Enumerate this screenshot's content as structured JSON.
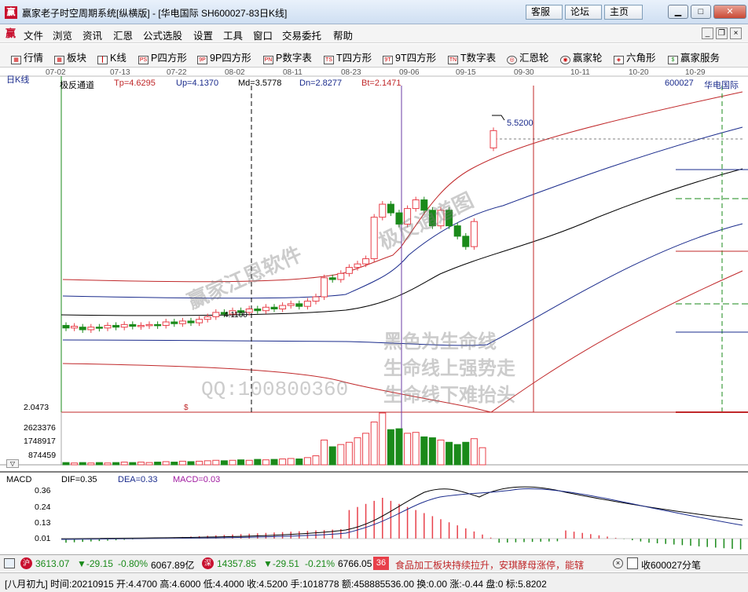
{
  "window": {
    "title": "赢家老子时空周期系统[纵横版] - [华电国际  SH600027-83日K线]",
    "app_icon": "赢",
    "nav_buttons": [
      "客服",
      "论坛",
      "主页"
    ]
  },
  "menu": {
    "logo": "赢",
    "items": [
      "文件",
      "浏览",
      "资讯",
      "汇恩",
      "公式选股",
      "设置",
      "工具",
      "窗口",
      "交易委托",
      "帮助"
    ]
  },
  "toolbar": {
    "items": [
      {
        "icon": "grid-icon",
        "glyph": "▦",
        "label": "行情"
      },
      {
        "icon": "blocks-icon",
        "glyph": "▦",
        "label": "板块"
      },
      {
        "icon": "kline-icon",
        "glyph": "┃",
        "label": "K线"
      },
      {
        "icon": "ps-icon",
        "glyph": "PS",
        "label": "P四方形"
      },
      {
        "icon": "9p-icon",
        "glyph": "9P",
        "label": "9P四方形"
      },
      {
        "icon": "pn-icon",
        "glyph": "PN",
        "label": "P数字表"
      },
      {
        "icon": "ts-icon",
        "glyph": "TS",
        "label": "T四方形"
      },
      {
        "icon": "9t-icon",
        "glyph": "9T",
        "label": "9T四方形"
      },
      {
        "icon": "tn-icon",
        "glyph": "TN",
        "label": "T数字表"
      },
      {
        "icon": "target-icon",
        "glyph": "◎",
        "label": "汇恩轮"
      },
      {
        "icon": "wheel-icon",
        "glyph": "◉",
        "label": "赢家轮"
      },
      {
        "icon": "hexagon-icon",
        "glyph": "◈",
        "label": "六角形"
      },
      {
        "icon": "dollar-icon",
        "glyph": "$",
        "label": "赢家服务"
      }
    ]
  },
  "chart_header": {
    "period_label": "日K线",
    "indicator_name": "极反通道",
    "tp": "Tp=4.6295",
    "up": "Up=4.1370",
    "md": "Md=3.5778",
    "dn": "Dn=2.8277",
    "bt": "Bt=2.1471",
    "stock_code": "600027",
    "stock_name": "华电国际"
  },
  "timeline": [
    "07-02",
    "07-13",
    "07-22",
    "08-02",
    "08-11",
    "08-23",
    "09-06",
    "09-15",
    "09-30",
    "10-11",
    "10-20",
    "10-29"
  ],
  "price_labels": {
    "high_marker": "5.5200",
    "low_axis": "2.0473",
    "mid_marker": "4.1100",
    "dollar": "$"
  },
  "volume_axis": [
    "2623376",
    "1748917",
    "874459"
  ],
  "watermarks": {
    "w1": "赢家江恩软件",
    "w2": "极反通道图",
    "w3": "黑色为生命线",
    "w4": "生命线上强势走",
    "w5": "生命线下难抬头",
    "qq": "QQ:100800360"
  },
  "macd": {
    "title": "MACD",
    "dif": "DIF=0.35",
    "dea": "DEA=0.33",
    "macd": "MACD=0.03",
    "axis": [
      "0.36",
      "0.24",
      "0.13",
      "0.01"
    ]
  },
  "status1": {
    "sh_index": "3613.07",
    "sh_change": "▼-29.15",
    "sh_pct": "-0.80%",
    "sh_amount": "6067.89亿",
    "sz_index": "14357.85",
    "sz_change": "▼-29.51",
    "sz_pct": "-0.21%",
    "sz_amount": "6766.05",
    "news_badge": "36",
    "news": "食品加工板块持续拉升，安琪酵母涨停，能辖",
    "right": "收600027分笔"
  },
  "status2": {
    "text": "[八月初九] 时间:20210915 开:4.4700 高:4.6000 低:4.4000 收:4.5200 手:1018778 额:458885536.00 换:0.00 涨:-0.44 盘:0 标:5.8202"
  },
  "colors": {
    "up": "#e8404a",
    "down": "#1a8a1a",
    "channel_red": "#c0282a",
    "channel_blue": "#1a2b8c",
    "lifeline": "#000000",
    "dif_line": "#000000",
    "dea_line": "#1a2b8c"
  },
  "chart_data": {
    "type": "candlestick",
    "title": "华电国际 SH600027 日K线",
    "ylim": [
      2.0473,
      5.8202
    ],
    "last_bar": {
      "date": "20210915",
      "open": 4.47,
      "high": 4.6,
      "low": 4.4,
      "close": 4.52,
      "volume": 1018778
    },
    "indicator": {
      "name": "极反通道",
      "Tp": 4.6295,
      "Up": 4.137,
      "Md": 3.5778,
      "Dn": 2.8277,
      "Bt": 2.1471
    },
    "candles": [
      {
        "o": 3.05,
        "c": 3.02
      },
      {
        "o": 3.02,
        "c": 3.04
      },
      {
        "o": 3.03,
        "c": 3.0
      },
      {
        "o": 3.0,
        "c": 3.03
      },
      {
        "o": 3.03,
        "c": 3.02
      },
      {
        "o": 3.02,
        "c": 3.05
      },
      {
        "o": 3.05,
        "c": 3.03
      },
      {
        "o": 3.03,
        "c": 3.06
      },
      {
        "o": 3.06,
        "c": 3.04
      },
      {
        "o": 3.04,
        "c": 3.05
      },
      {
        "o": 3.05,
        "c": 3.06
      },
      {
        "o": 3.06,
        "c": 3.05
      },
      {
        "o": 3.05,
        "c": 3.09
      },
      {
        "o": 3.09,
        "c": 3.07
      },
      {
        "o": 3.07,
        "c": 3.1
      },
      {
        "o": 3.1,
        "c": 3.08
      },
      {
        "o": 3.08,
        "c": 3.12
      },
      {
        "o": 3.12,
        "c": 3.15
      },
      {
        "o": 3.15,
        "c": 3.2
      },
      {
        "o": 3.2,
        "c": 3.18
      },
      {
        "o": 3.18,
        "c": 3.22
      },
      {
        "o": 3.22,
        "c": 3.2
      },
      {
        "o": 3.2,
        "c": 3.24
      },
      {
        "o": 3.24,
        "c": 3.22
      },
      {
        "o": 3.22,
        "c": 3.26
      },
      {
        "o": 3.26,
        "c": 3.24
      },
      {
        "o": 3.24,
        "c": 3.28
      },
      {
        "o": 3.28,
        "c": 3.3
      },
      {
        "o": 3.3,
        "c": 3.27
      },
      {
        "o": 3.27,
        "c": 3.33
      },
      {
        "o": 3.33,
        "c": 3.38
      },
      {
        "o": 3.38,
        "c": 3.6
      },
      {
        "o": 3.6,
        "c": 3.58
      },
      {
        "o": 3.58,
        "c": 3.65
      },
      {
        "o": 3.65,
        "c": 3.72
      },
      {
        "o": 3.72,
        "c": 3.76
      },
      {
        "o": 3.76,
        "c": 3.82
      },
      {
        "o": 3.82,
        "c": 4.3
      },
      {
        "o": 4.3,
        "c": 4.45
      },
      {
        "o": 4.45,
        "c": 4.35
      },
      {
        "o": 4.35,
        "c": 4.22
      },
      {
        "o": 4.22,
        "c": 4.4
      },
      {
        "o": 4.4,
        "c": 4.5
      },
      {
        "o": 4.5,
        "c": 4.38
      },
      {
        "o": 4.38,
        "c": 4.2
      },
      {
        "o": 4.2,
        "c": 4.38
      },
      {
        "o": 4.38,
        "c": 4.2
      },
      {
        "o": 4.2,
        "c": 4.08
      },
      {
        "o": 4.08,
        "c": 3.96
      },
      {
        "o": 3.96,
        "c": 4.25
      },
      {
        "o": 5.1,
        "c": 5.3
      }
    ],
    "volumes": [
      5,
      4,
      5,
      4,
      5,
      4,
      5,
      6,
      5,
      6,
      5,
      6,
      7,
      6,
      8,
      7,
      8,
      9,
      10,
      9,
      10,
      11,
      10,
      12,
      11,
      12,
      13,
      14,
      13,
      16,
      20,
      55,
      40,
      45,
      50,
      60,
      70,
      95,
      115,
      78,
      80,
      70,
      72,
      62,
      60,
      55,
      50,
      45,
      50,
      58,
      38
    ],
    "macd": {
      "dif_peak": 0.36,
      "dea_peak": 0.33,
      "last": {
        "dif": 0.35,
        "dea": 0.33,
        "macd": 0.03
      }
    }
  }
}
